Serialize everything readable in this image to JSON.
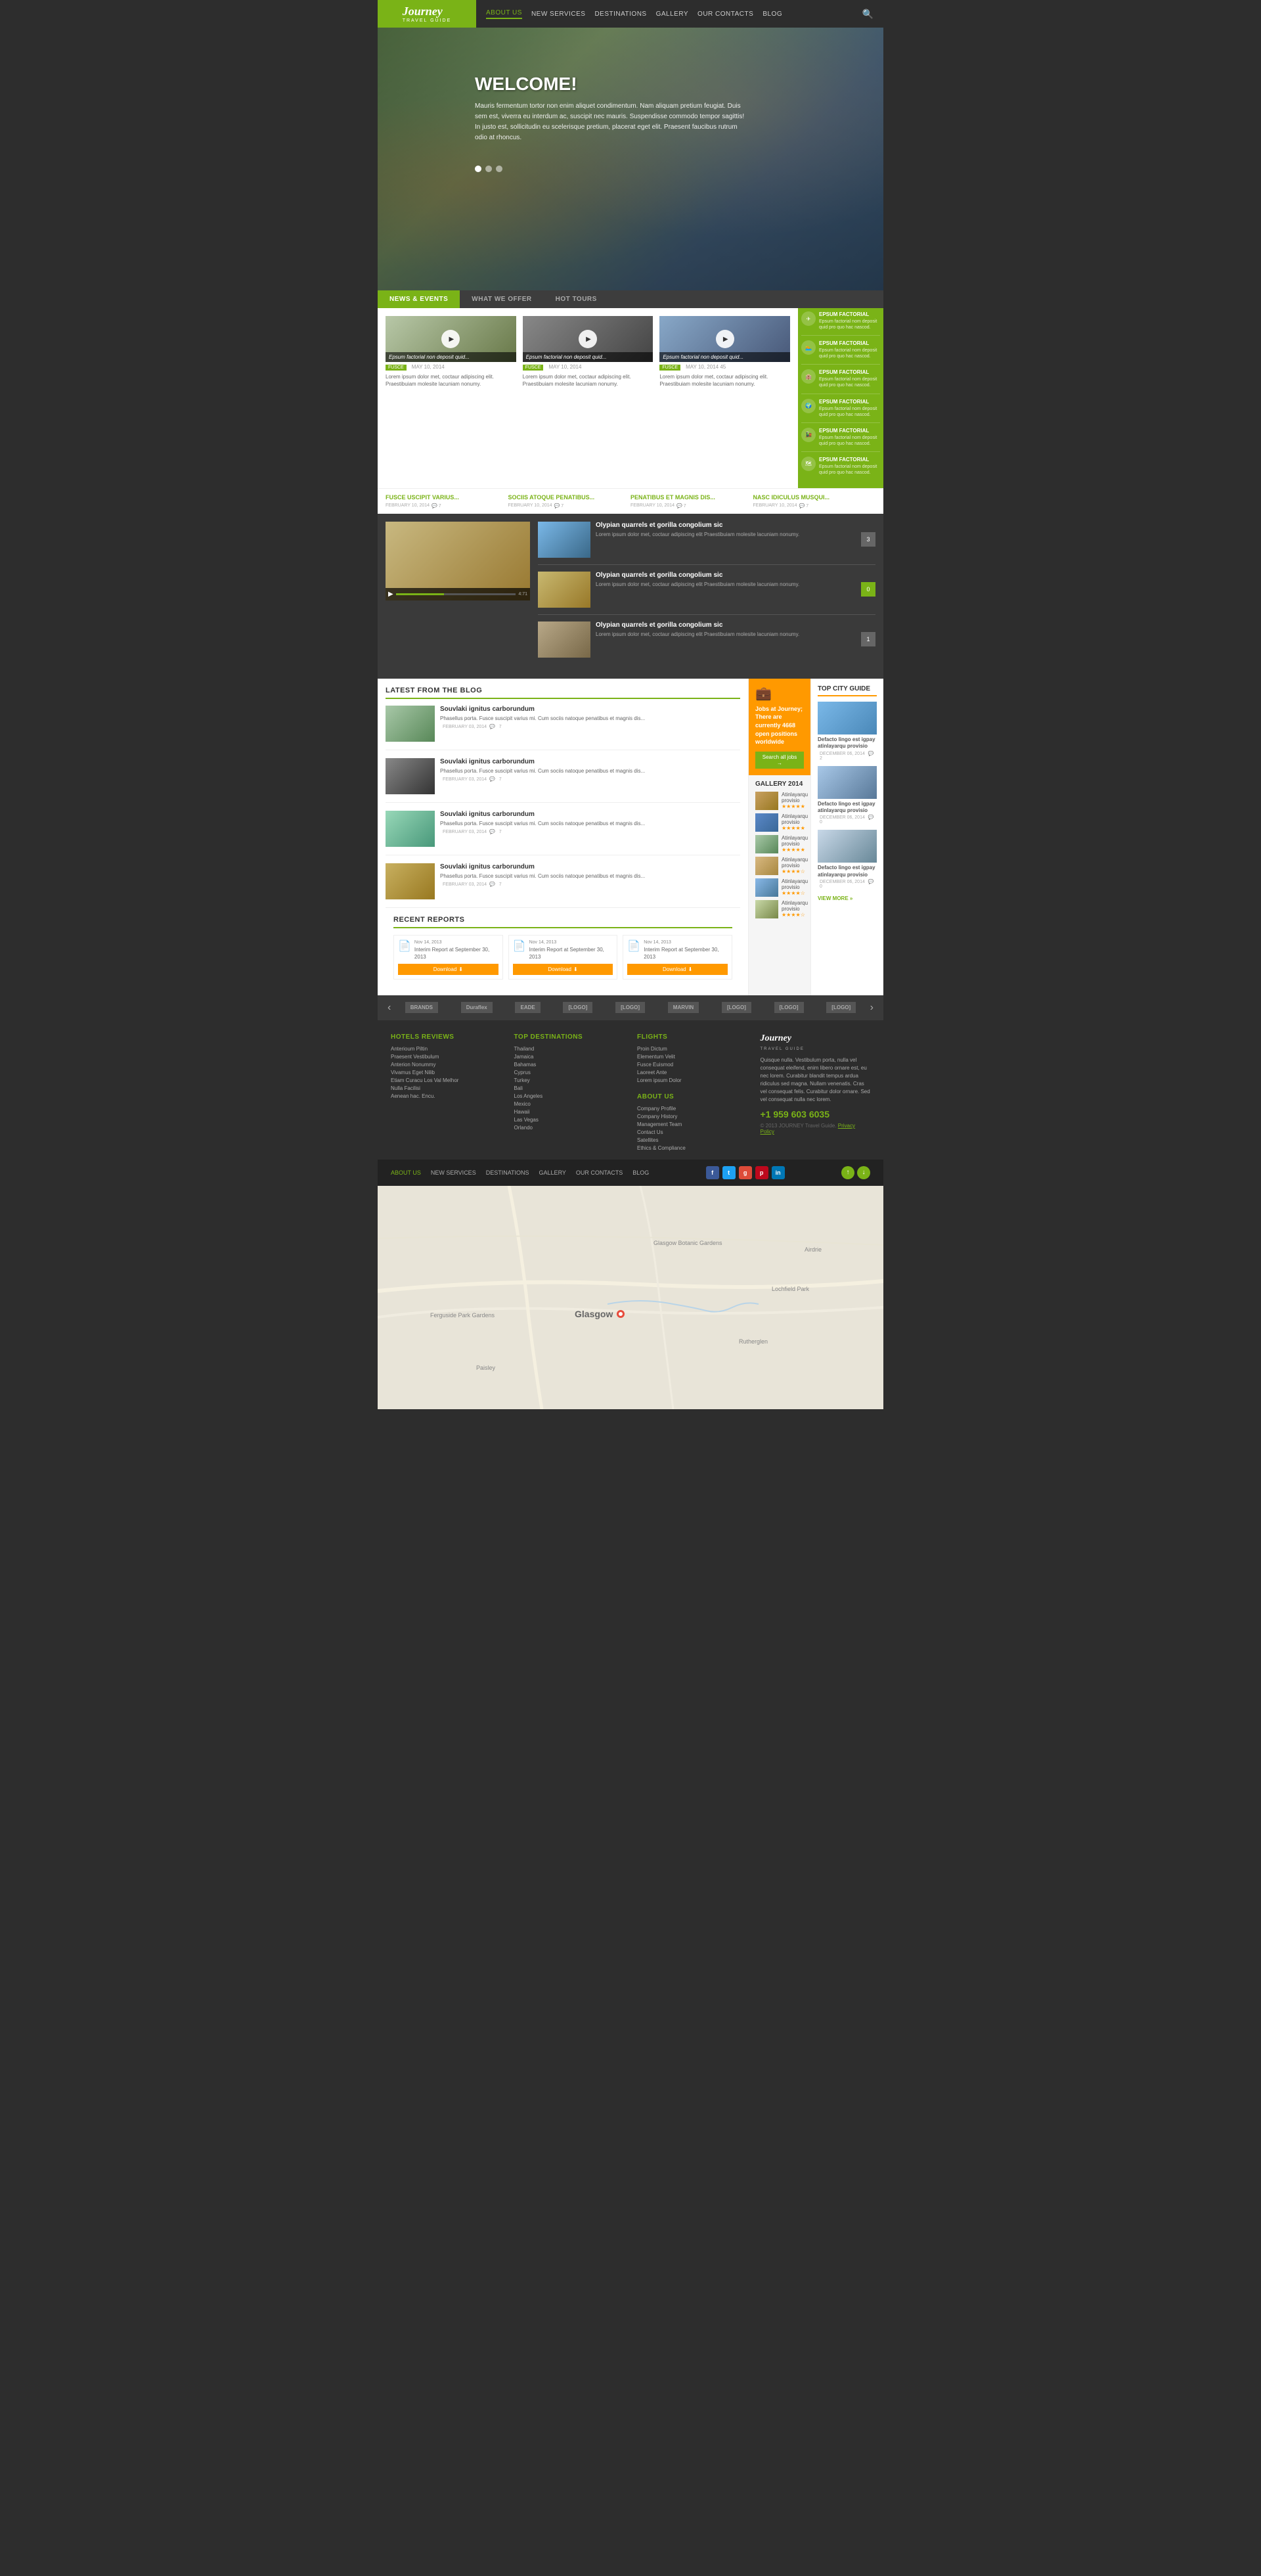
{
  "site": {
    "logo": "Journey",
    "logo_sub": "TRAVEL GUIDE",
    "tagline": "Travel Guide"
  },
  "nav": {
    "items": [
      {
        "label": "ABOUT US",
        "active": true
      },
      {
        "label": "NEW SERVICES"
      },
      {
        "label": "DESTINATIONS"
      },
      {
        "label": "GALLERY"
      },
      {
        "label": "OUR CONTACTS"
      },
      {
        "label": "BLOG"
      }
    ]
  },
  "hero": {
    "title": "WELCOME!",
    "body": "Mauris fermentum tortor non enim aliquet condimentum. Nam aliquam pretium feugiat. Duis sem est, viverra eu interdum ac, suscipit nec mauris. Suspendisse commodo tempor sagittis! In justo est, sollicitudin eu scelerisque pretium, placerat eget elit. Praesent faucibus rutrum odio at rhoncus."
  },
  "tabs": [
    {
      "label": "NEWS & EVENTS",
      "active": true
    },
    {
      "label": "WHAT WE OFFER"
    },
    {
      "label": "HOT TOURS"
    }
  ],
  "news_cards": [
    {
      "caption": "Epsum factorial non deposit quid...",
      "tag": "FUSCE",
      "date": "MAY 10, 2014",
      "text": "Lorem ipsum dolor met, coctaur adipiscing elit. Praestibuiam molesite lacuniam nonumy."
    },
    {
      "caption": "Epsum factorial non deposit quid...",
      "tag": "FUSCE",
      "date": "MAY 10, 2014",
      "text": "Lorem ipsum dolor met, coctaur adipiscing elit. Praestibuiam molesite lacuniam nonumy."
    },
    {
      "caption": "Epsum factorial non deposit quid...",
      "tag": "FUSCE",
      "date": "MAY 10, 2014 45",
      "text": "Lorem ipsum dolor met, coctaur adipiscing elit. Praestibuiam molesite lacuniam nonumy."
    }
  ],
  "sidebar_items": [
    {
      "icon": "✈",
      "title": "EPSUM FACTORIAL",
      "text": "Epsum factorial nom deposit quid pro quo hac nascod."
    },
    {
      "icon": "🏊",
      "title": "EPSUM FACTORIAL",
      "text": "Epsum factorial nom deposit quid pro quo hac nascod."
    },
    {
      "icon": "🏨",
      "title": "EPSUM FACTORIAL",
      "text": "Epsum factorial nom deposit quid pro quo hac nascod."
    },
    {
      "icon": "🌍",
      "title": "EPSUM FACTORIAL",
      "text": "Epsum factorial nom deposit quid pro quo hac nascod."
    },
    {
      "icon": "🚂",
      "title": "EPSUM FACTORIAL",
      "text": "Epsum factorial nom deposit quid pro quo hac nascod."
    },
    {
      "icon": "🗺",
      "title": "EPSUM FACTORIAL",
      "text": "Epsum factorial nom deposit quid pro quo hac nascod."
    }
  ],
  "link_items": [
    {
      "title": "FUSCE USCIPIT VARIUS...",
      "date": "FEBRUARY 10, 2014",
      "comments": "7"
    },
    {
      "title": "SOCIIS ATOQUE PENATIBUS...",
      "date": "FEBRUARY 10, 2014",
      "comments": "7"
    },
    {
      "title": "PENATIBUS ET MAGNIS DIS...",
      "date": "FEBRUARY 10, 2014",
      "comments": "7"
    },
    {
      "title": "NASC IDICULUS MUSQUI...",
      "date": "FEBRUARY 10, 2014",
      "comments": "7"
    }
  ],
  "dark_news": [
    {
      "title": "Olypian quarrels et gorilla congolium sic",
      "text": "Lorem ipsum dolor met, coctaur adipiscing elit Praestibuiam molesite lacuniam nonumy.",
      "num": "3",
      "numClass": ""
    },
    {
      "title": "Olypian quarrels et gorilla congolium sic",
      "text": "Lorem ipsum dolor met, coctaur adipiscing elit Praestibuiam molesite lacuniam nonumy.",
      "num": "0",
      "numClass": "green"
    },
    {
      "title": "Olypian quarrels et gorilla congolium sic",
      "text": "Lorem ipsum dolor met, coctaur adipiscing elit Praestibuiam molesite lacuniam nonumy.",
      "num": "1",
      "numClass": ""
    }
  ],
  "blog": {
    "section_title": "LATEST FROM THE BLOG",
    "posts": [
      {
        "title": "Souvlaki ignitus carborundum",
        "text": "Phasellus porta. Fusce suscipit varius mi. Cum sociis natoque penatibus et magnis dis...",
        "date": "FEBRUARY 03, 2014",
        "comments": "7"
      },
      {
        "title": "Souvlaki ignitus carborundum",
        "text": "Phasellus porta. Fusce suscipit varius mi. Cum sociis natoque penatibus et magnis dis...",
        "date": "FEBRUARY 03, 2014",
        "comments": "7"
      },
      {
        "title": "Souvlaki ignitus carborundum",
        "text": "Phasellus porta. Fusce suscipit varius mi. Cum sociis natoque penatibus et magnis dis...",
        "date": "FEBRUARY 03, 2014",
        "comments": "7"
      },
      {
        "title": "Souvlaki ignitus carborundum",
        "text": "Phasellus porta. Fusce suscipit varius mi. Cum sociis natoque penatibus et magnis dis...",
        "date": "FEBRUARY 03, 2014",
        "comments": "7"
      }
    ]
  },
  "reports": {
    "title": "RECENT REPORTS",
    "items": [
      {
        "date": "Nov 14, 2013",
        "text": "Interim Report at September 30, 2013",
        "download_label": "Download"
      },
      {
        "date": "Nov 14, 2013",
        "text": "Interim Report at September 30, 2013",
        "download_label": "Download"
      },
      {
        "date": "Nov 14, 2013",
        "text": "Interim Report at September 30, 2013",
        "download_label": "Download"
      }
    ]
  },
  "jobs": {
    "icon": "💼",
    "text": "Jobs at Journey; There are currently 4668 open positions worldwide",
    "btn_label": "Search all jobs →"
  },
  "gallery": {
    "title": "GALLERY 2014",
    "items": [
      {
        "label": "Atinlayarqu provisio",
        "stars": "★★★★★"
      },
      {
        "label": "Atinlayarqu provisio",
        "stars": "★★★★★"
      },
      {
        "label": "Atinlayarqu provisio",
        "stars": "★★★★★"
      },
      {
        "label": "Atinlayarqu provisio",
        "stars": "★★★★☆"
      },
      {
        "label": "Atinlayarqu provisio",
        "stars": "★★★★☆"
      },
      {
        "label": "Atinlayarqu provisio",
        "stars": "★★★★☆"
      }
    ]
  },
  "city_guide": {
    "title": "TOP CITY GUIDE",
    "items": [
      {
        "title": "Defacto lingo est igpay atinlayarqu provisio",
        "date": "DECEMBER 06, 2014",
        "comments": "2"
      },
      {
        "title": "Defacto lingo est igpay atinlayarqu provisio",
        "date": "DECEMBER 06, 2014",
        "comments": "0"
      },
      {
        "title": "Defacto lingo est igpay atinlayarqu provisio",
        "date": "DECEMBER 06, 2014",
        "comments": "0"
      }
    ],
    "view_more": "VIEW MORE »"
  },
  "brands": [
    "BRANDS",
    "Duraflex",
    "EADE",
    "[LOGO]",
    "[LOGO]",
    "MARVIN",
    "[LOGO]",
    "[LOGO]",
    "[LOGO]"
  ],
  "footer": {
    "hotels": {
      "title": "HOTELS REVIEWS",
      "links": [
        "Anterioum Piltin",
        "Praesent Vestibulum",
        "Anterion Nonummy",
        "Vivamus Eget Nilib",
        "Etiam Curacu Los Val Melhor",
        "Nulla Facilisi",
        "Aenean hac. Encu."
      ]
    },
    "destinations": {
      "title": "TOP DESTINATIONS",
      "links": [
        "Thailand",
        "Jamaica",
        "Bahamas",
        "Cyprus",
        "Turkey",
        "Bali",
        "Los Angeles",
        "Mexico",
        "Hawaii",
        "Las Vegas",
        "Orlando"
      ]
    },
    "flights": {
      "title": "FLIGHTS",
      "links": [
        "Proin Dictum",
        "Elementum Velit",
        "Fusce Euismod",
        "Laoreet Ante",
        "Lorem ipsum Dolor"
      ]
    },
    "about": {
      "title": "ABOUT US",
      "links": [
        "Company Profile",
        "Company History",
        "Management Team",
        "Contact Us",
        "Satellites",
        "Ethics & Compliance"
      ]
    },
    "brand": {
      "logo": "Journey",
      "sub": "TRAVEL GUIDE",
      "desc": "Quisque nulla. Vestibulum porta, nulla vel consequat eleifend, enim libero ornare est, eu nec lorem. Curabitur blandit tempus ardua ridiculus sed magna. Nullam venenatis. Cras vel consequat felis. Curabitur dolor ornare. Sed vel consequat nulla nec lorem.",
      "phone": "+1 959 603 6035",
      "copy": "© 2013 JOURNEY Travel Guide.",
      "privacy": "Privacy Policy"
    }
  },
  "bottom_nav": {
    "links": [
      {
        "label": "ABOUT US",
        "active": true
      },
      {
        "label": "NEW SERVICES"
      },
      {
        "label": "DESTINATIONS"
      },
      {
        "label": "GALLERY"
      },
      {
        "label": "OUR CONTACTS"
      },
      {
        "label": "BLOG"
      }
    ]
  }
}
